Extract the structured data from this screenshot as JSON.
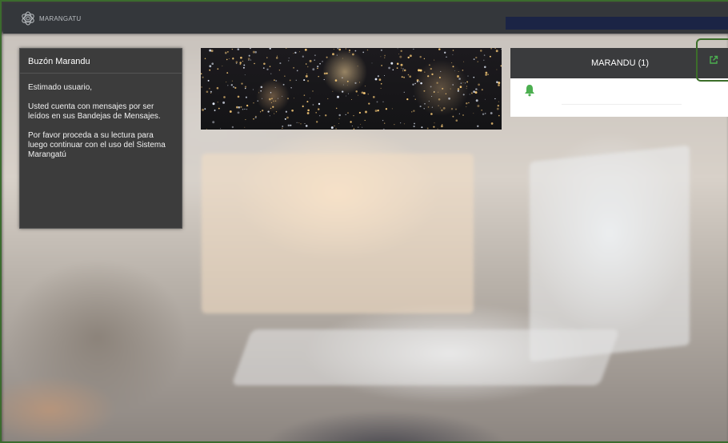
{
  "app": {
    "brand": "MARANGATU"
  },
  "left_panel": {
    "title": "Buzón Marandu",
    "greeting": "Estimado usuario,",
    "paragraph1": "Usted cuenta con mensajes por ser leídos en sus Bandejas de Mensajes.",
    "paragraph2": "Por favor proceda a su lectura para luego continuar con el uso del Sistema Marangatú"
  },
  "right_panel": {
    "title": "MARANDU (1)",
    "external_link_icon": "external-link-icon",
    "bell_icon": "bell-icon"
  },
  "colors": {
    "navbar": "#34373b",
    "accent_green": "#4caf50",
    "panel_dark": "#3c3c3c"
  }
}
